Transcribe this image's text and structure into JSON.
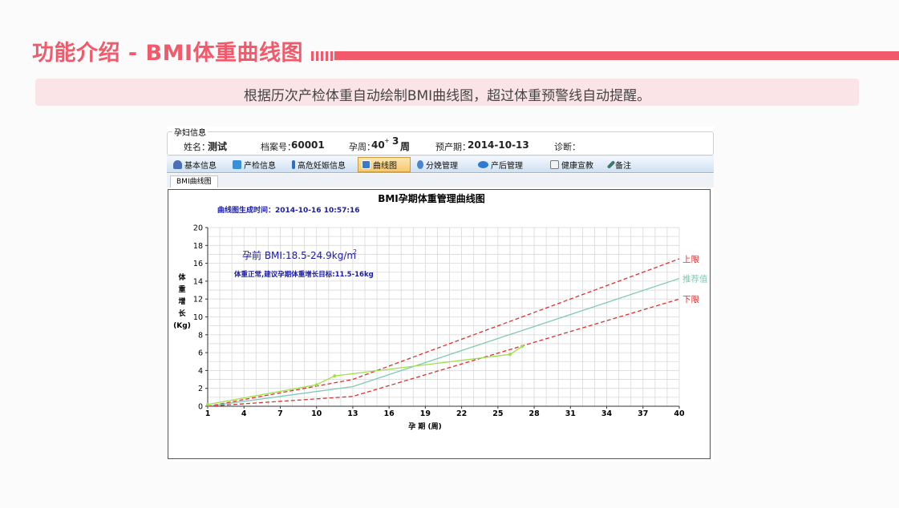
{
  "slide": {
    "title": "功能介绍 - BMI体重曲线图",
    "subtitle": "根据历次产检体重自动绘制BMI曲线图，超过体重预警线自动提醒。"
  },
  "patient_info": {
    "group_label": "孕妇信息",
    "name_label": "姓名：",
    "name_value": "测试",
    "file_label": "档案号：",
    "file_value": "60001",
    "week_label": "孕周：",
    "week_value": "40",
    "week_plus": "+",
    "week_days": "3",
    "week_unit": "周",
    "due_label": "预产期：",
    "due_value": "2014-10-13",
    "diagnosis_label": "诊断："
  },
  "toolbar": {
    "items": [
      {
        "label": "基本信息",
        "icon": "person-icon",
        "color": "#4a6fb5"
      },
      {
        "label": "产检信息",
        "icon": "calendar-icon",
        "color": "#3b8fd6"
      },
      {
        "label": "高危妊娠信息",
        "icon": "exclamation-icon",
        "color": "#2d6fc4"
      },
      {
        "label": "曲线图",
        "icon": "chart-icon",
        "color": "#3a7ac8",
        "active": true
      },
      {
        "label": "分娩管理",
        "icon": "baby-icon",
        "color": "#4a84d0"
      },
      {
        "label": "产后管理",
        "icon": "eye-icon",
        "color": "#2f7bd1"
      },
      {
        "label": "健康宣教",
        "icon": "document-icon",
        "color": "#7a7a7a"
      },
      {
        "label": "备注",
        "icon": "pen-icon",
        "color": "#3a7a6a"
      }
    ]
  },
  "tabs": [
    {
      "label": "BMI曲线图"
    }
  ],
  "chart_data": {
    "type": "line",
    "title": "BMI孕期体重管理曲线图",
    "generated_label": "曲线图生成时间：2014-10-16 10:57:16",
    "annotation_bmi": "孕前 BMI:18.5-24.9kg/m",
    "annotation_bmi_sup": "2",
    "annotation_target": "体重正常,建议孕期体重增长目标:11.5-16kg",
    "xlabel": "孕 期 (周)",
    "ylabel_chars": [
      "体",
      "重",
      "增",
      "长",
      "(Kg)"
    ],
    "xlim": [
      1,
      40
    ],
    "ylim": [
      0,
      20
    ],
    "x_ticks": [
      1,
      4,
      7,
      10,
      13,
      16,
      19,
      22,
      25,
      28,
      31,
      34,
      37,
      40
    ],
    "y_ticks": [
      0,
      2,
      4,
      6,
      8,
      10,
      12,
      14,
      16,
      18,
      20
    ],
    "series": [
      {
        "name": "上限",
        "color": "#e03030",
        "dash": true,
        "x": [
          1,
          13,
          40
        ],
        "y": [
          0,
          3,
          16.5
        ]
      },
      {
        "name": "推荐值",
        "color": "#7fc9b4",
        "dash": false,
        "x": [
          1,
          13,
          40
        ],
        "y": [
          0,
          2.2,
          14.3
        ]
      },
      {
        "name": "下限",
        "color": "#e03030",
        "dash": true,
        "x": [
          1,
          13,
          40
        ],
        "y": [
          0,
          1.1,
          12
        ]
      },
      {
        "name": "",
        "color": "#9ee04a",
        "dash": false,
        "marker": true,
        "x": [
          1,
          10,
          11.5,
          26,
          27
        ],
        "y": [
          0.2,
          2.4,
          3.4,
          5.8,
          6.7
        ]
      }
    ]
  }
}
